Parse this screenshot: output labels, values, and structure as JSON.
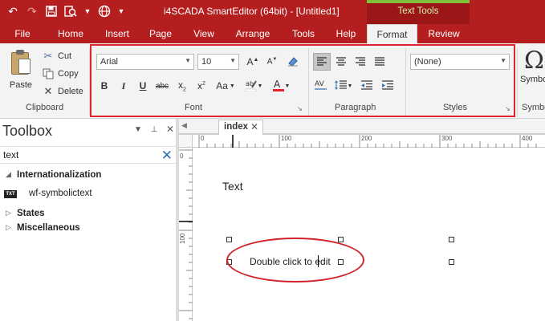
{
  "window": {
    "title": "i4SCADA SmartEditor (64bit) - [Untitled1]",
    "context_tab_group": "Text Tools"
  },
  "ribbon_tabs": [
    {
      "label": "File",
      "active": false
    },
    {
      "label": "Home",
      "active": false
    },
    {
      "label": "Insert",
      "active": false
    },
    {
      "label": "Page",
      "active": false
    },
    {
      "label": "View",
      "active": false
    },
    {
      "label": "Arrange",
      "active": false
    },
    {
      "label": "Tools",
      "active": false
    },
    {
      "label": "Help",
      "active": false
    },
    {
      "label": "Format",
      "active": true
    },
    {
      "label": "Review",
      "active": false
    }
  ],
  "clipboard": {
    "group_label": "Clipboard",
    "paste": "Paste",
    "cut": "Cut",
    "copy": "Copy",
    "delete": "Delete"
  },
  "font": {
    "group_label": "Font",
    "family": "Arial",
    "size": "10",
    "bold": "B",
    "italic": "I",
    "underline": "U",
    "strikethrough": "abc",
    "change_case": "Aa"
  },
  "paragraph": {
    "group_label": "Paragraph"
  },
  "styles": {
    "group_label": "Styles",
    "selected": "(None)"
  },
  "symbols": {
    "button_label": "Symbols",
    "group_label": "Symbols"
  },
  "toolbox": {
    "title": "Toolbox",
    "search_value": "text",
    "tree": [
      {
        "label": "Internationalization",
        "expanded": true,
        "children": [
          {
            "label": "wf-symbolictext",
            "badge": "TXT"
          }
        ]
      },
      {
        "label": "States",
        "expanded": false
      },
      {
        "label": "Miscellaneous",
        "expanded": false
      }
    ]
  },
  "document": {
    "tab_name": "index",
    "ruler_top_labels": [
      "0",
      "100",
      "200",
      "300",
      "400"
    ],
    "ruler_left_labels": [
      "0",
      "100"
    ],
    "static_text": "Text",
    "editing_text": "Double click to edit"
  },
  "colors": {
    "accent": "#b41e1e",
    "context_group_bar": "#7fbf3a",
    "annotation": "#e0252e"
  }
}
